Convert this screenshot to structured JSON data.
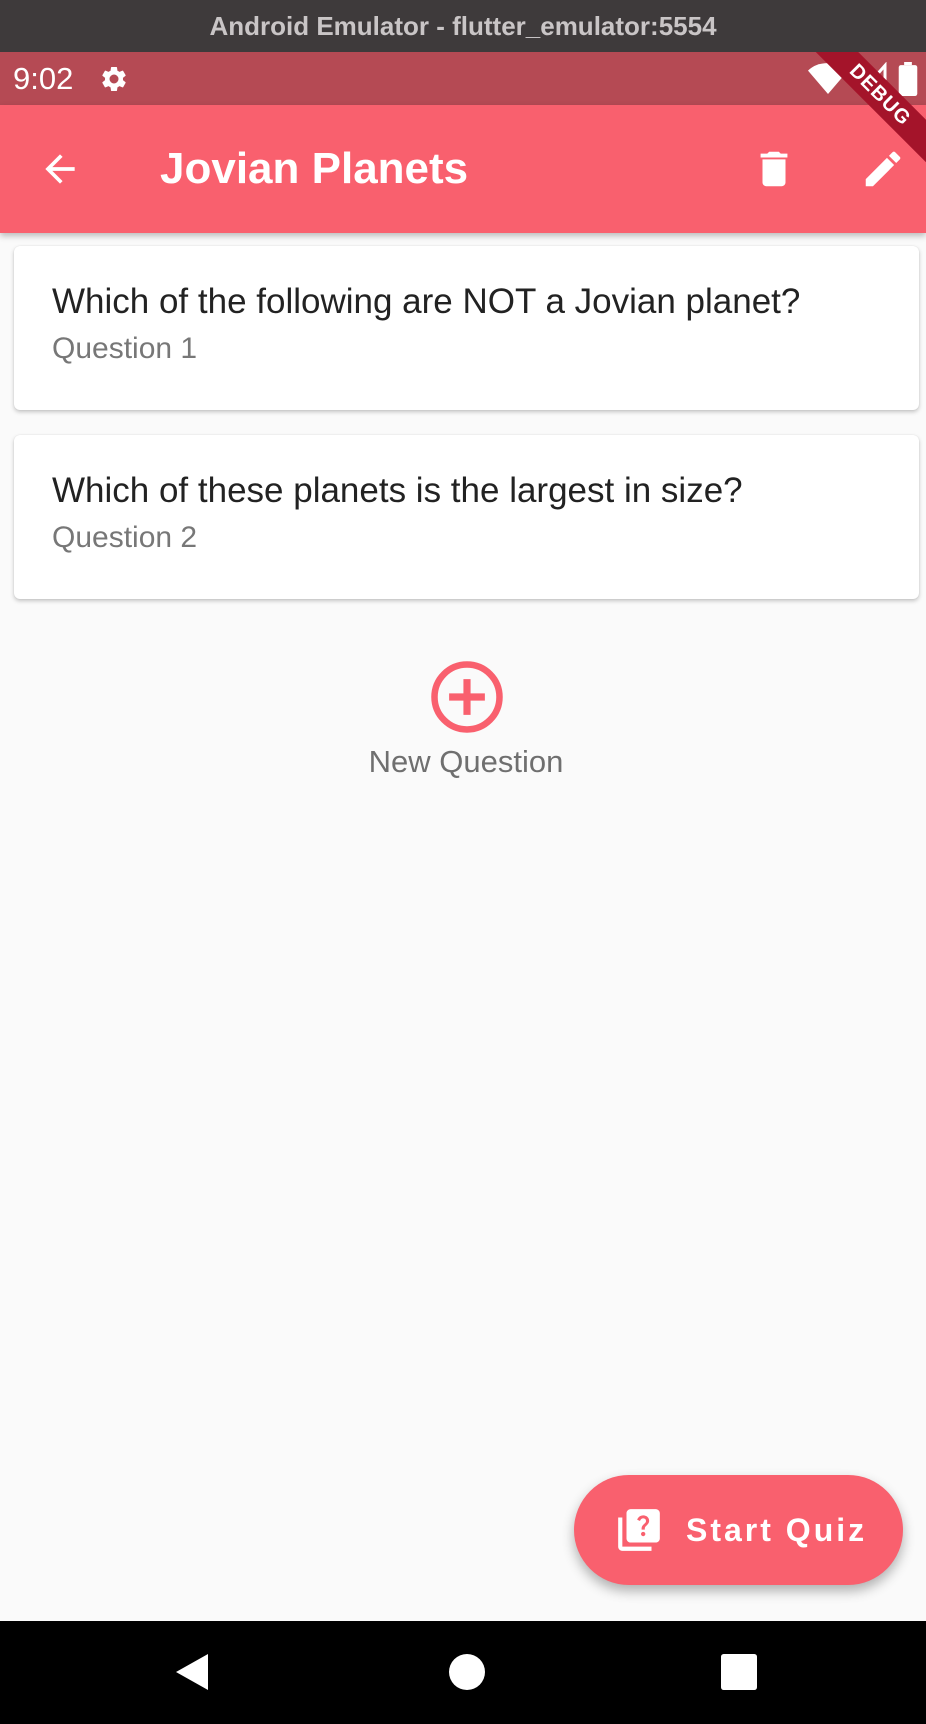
{
  "window": {
    "title": "Android Emulator - flutter_emulator:5554"
  },
  "status_bar": {
    "time": "9:02",
    "icons": [
      "settings-icon",
      "wifi-icon",
      "signal-icon",
      "battery-icon"
    ]
  },
  "debug_banner": {
    "label": "DEBUG"
  },
  "app_bar": {
    "title": "Jovian Planets",
    "back_icon": "arrow-back-icon",
    "delete_icon": "delete-icon",
    "edit_icon": "edit-icon"
  },
  "questions": [
    {
      "title": "Which of the following are NOT a Jovian planet?",
      "subtitle": "Question 1"
    },
    {
      "title": "Which of these planets is the largest in size?",
      "subtitle": "Question 2"
    }
  ],
  "new_question": {
    "label": "New Question",
    "icon": "add-circle-icon"
  },
  "fab": {
    "label": "Start Quiz",
    "icon": "quiz-icon"
  },
  "nav_bar": {
    "buttons": [
      "back-triangle-icon",
      "home-circle-icon",
      "recents-square-icon"
    ]
  },
  "colors": {
    "primary": "#f9606e",
    "status_bar": "#b54a54",
    "background": "#fafafa"
  }
}
